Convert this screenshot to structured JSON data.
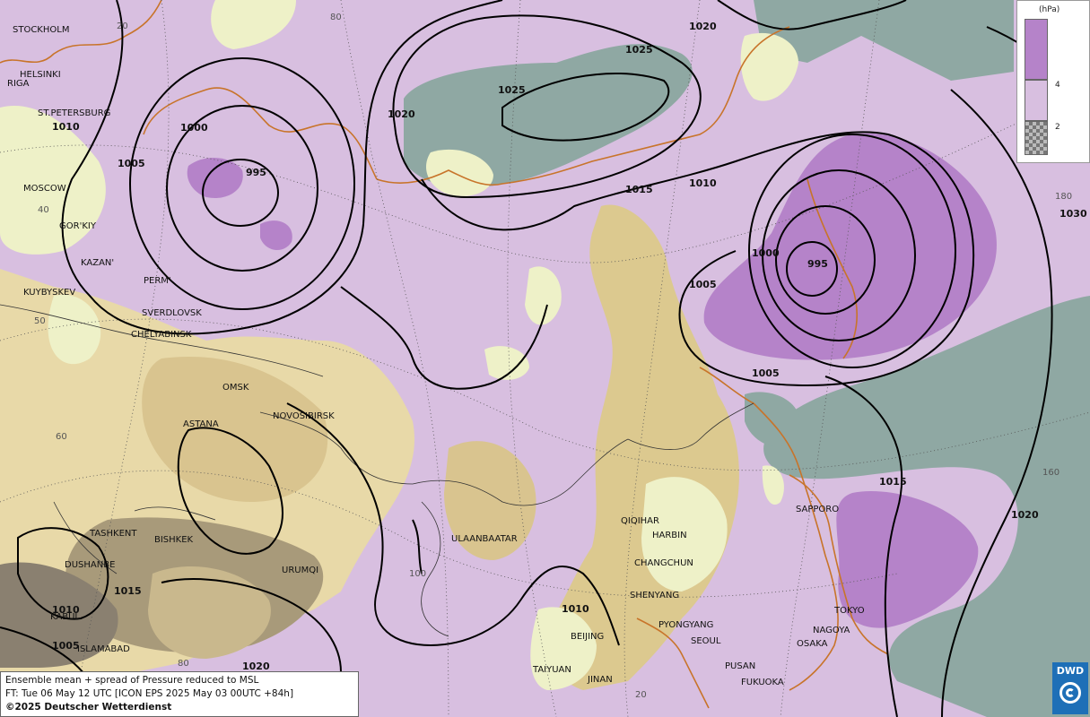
{
  "legend": {
    "unit": "(hPa)",
    "ticks": [
      "4",
      "2"
    ],
    "colors": {
      "high_spread": "#b583c9",
      "mid_spread": "#d8bfe0",
      "low_spread": "#8fa8a3"
    }
  },
  "info": {
    "line1": "Ensemble mean + spread of Pressure reduced to MSL",
    "line2": "FT: Tue 06 May 12 UTC [ICON EPS 2025 May 03 00UTC +84h]",
    "line3": "©2025 Deutscher Wetterdienst"
  },
  "logo": {
    "text": "DWD"
  },
  "cities": {
    "stockholm": "STOCKHOLM",
    "helsinki": "HELSINKI",
    "riga": "RIGA",
    "st_petersburg": "ST.PETERSBURG",
    "moscow": "MOSCOW",
    "gorkiy": "GOR'KIY",
    "kazan": "KAZAN'",
    "kuybyshev": "KUYBYSKEV",
    "perm": "PERM'",
    "sverdlovsk": "SVERDLOVSK",
    "chelyabinsk": "CHELYABINSK",
    "omsk": "OMSK",
    "novosibirsk": "NOVOSIBIRSK",
    "astana": "ASTANA",
    "tashkent": "TASHKENT",
    "bishkek": "BISHKEK",
    "dushanbe": "DUSHANBE",
    "urumqi": "URUMQI",
    "kabul": "KABUL",
    "islamabad": "ISLAMABAD",
    "ulaanbaatar": "ULAANBAATAR",
    "qiqihar": "QIQIHAR",
    "harbin": "HARBIN",
    "changchun": "CHANGCHUN",
    "shenyang": "SHENYANG",
    "beijing": "BEIJING",
    "taiyuan": "TAIYUAN",
    "jinan": "JINAN",
    "pyongyang": "PYONGYANG",
    "seoul": "SEOUL",
    "pusan": "PUSAN",
    "fukuoka": "FUKUOKA",
    "osaka": "OSAKA",
    "nagoya": "NAGOYA",
    "tokyo": "TOKYO",
    "sapporo": "SAPPORO"
  },
  "isobars": {
    "i1020_north": "1020",
    "i1025_a": "1025",
    "i1025_b": "1025",
    "i1020_arc": "1020",
    "i1010_w": "1010",
    "i1000_w": "1000",
    "i1005_w": "1005",
    "i995_w": "995",
    "i1015_c": "1015",
    "i1010_e": "1010",
    "i1005_e": "1005",
    "i1000_e": "1000",
    "i995_e": "995",
    "i1005_se": "1005",
    "i1030": "1030",
    "i1015_j": "1015",
    "i1020_j": "1020",
    "i1010_b": "1010",
    "i1015_sw": "1015",
    "i1010_sw": "1010",
    "i1005_sw": "1005",
    "i1020_s": "1020"
  },
  "degrees": {
    "d20_top": "20",
    "d80_top": "80",
    "d40": "40",
    "d50": "50",
    "d60": "60",
    "d100": "100",
    "d80_bot": "80",
    "d20_bot": "20",
    "d180": "180",
    "d160": "160"
  }
}
